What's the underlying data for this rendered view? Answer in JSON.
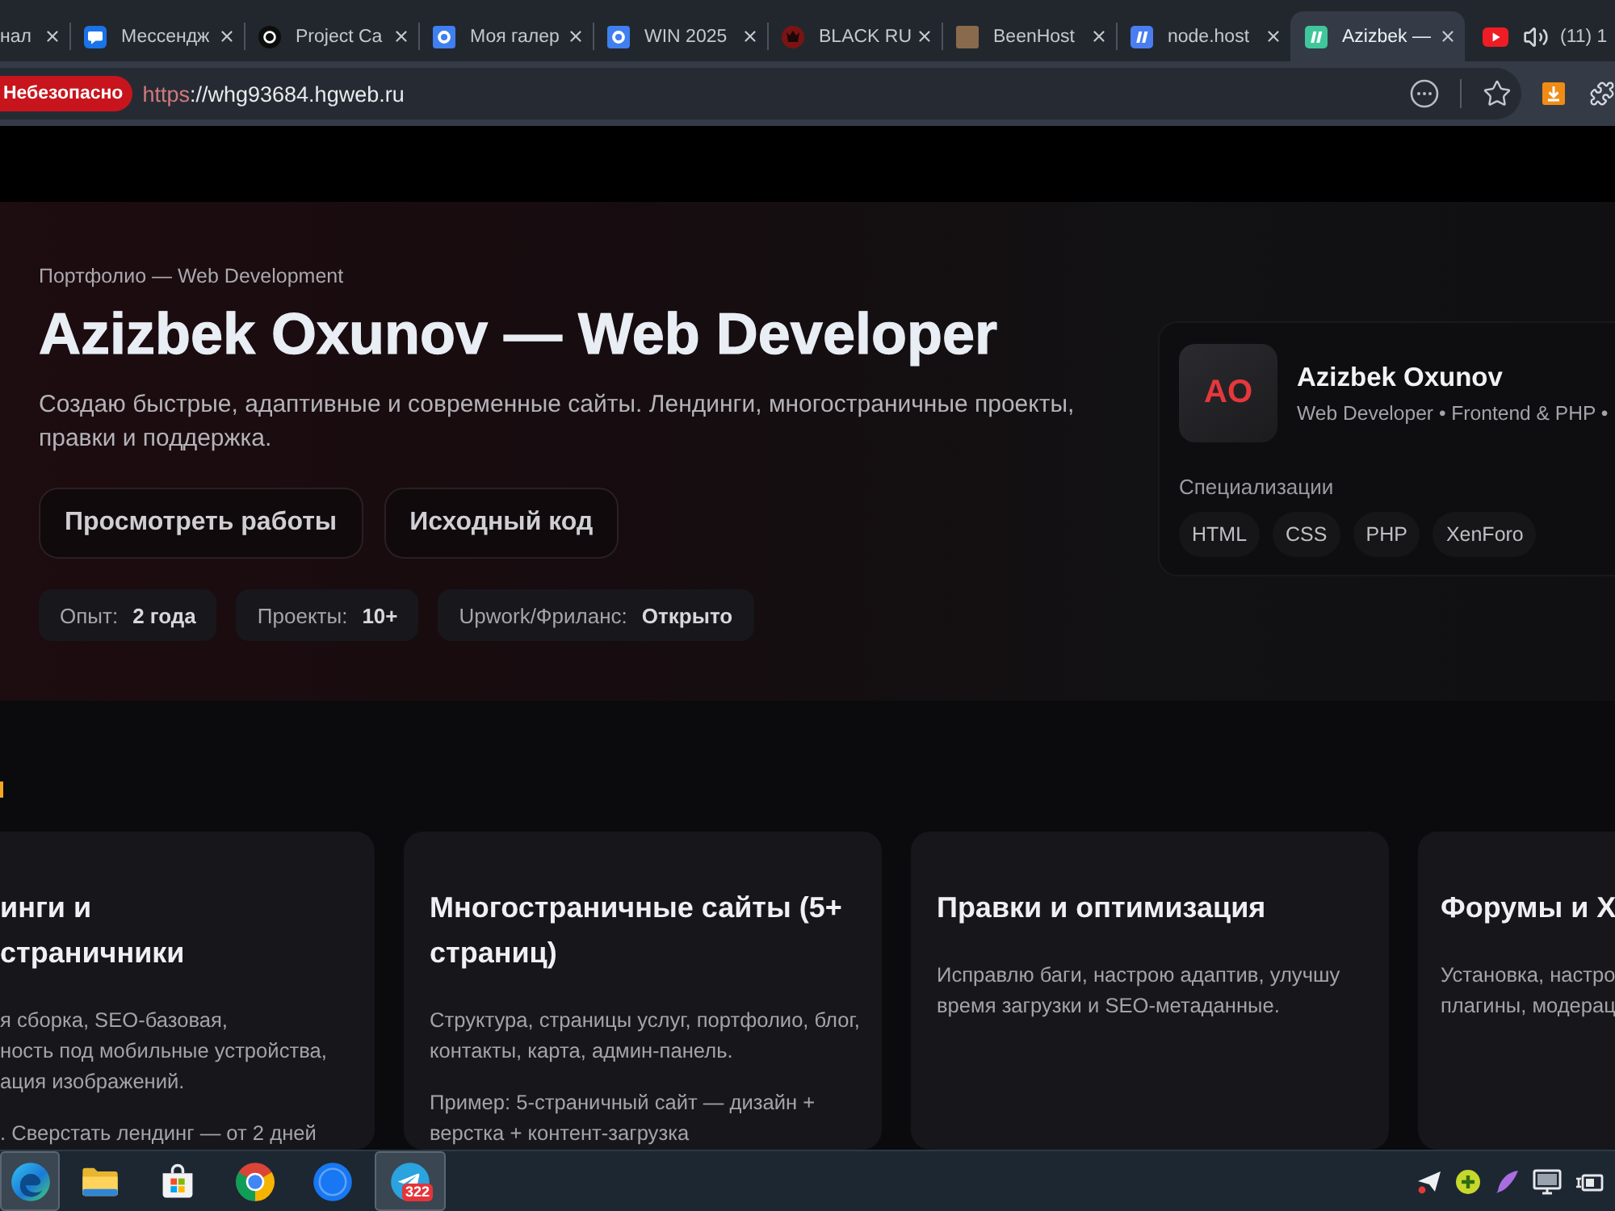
{
  "browser": {
    "tabs": [
      {
        "kind": "none",
        "title": "нал",
        "selected": false,
        "closable": true,
        "sound": false
      },
      {
        "kind": "bubble",
        "title": "Мессендж",
        "selected": false,
        "closable": true,
        "sound": false
      },
      {
        "kind": "disc",
        "title": "Project Ca",
        "selected": false,
        "closable": true,
        "sound": false
      },
      {
        "kind": "tile",
        "title": "Моя галер",
        "selected": false,
        "closable": true,
        "sound": false
      },
      {
        "kind": "tile",
        "title": "WIN 2025",
        "selected": false,
        "closable": true,
        "sound": false
      },
      {
        "kind": "emblem",
        "title": "BLACK RU",
        "selected": false,
        "closable": true,
        "sound": false
      },
      {
        "kind": "photo",
        "title": "BeenHost",
        "selected": false,
        "closable": true,
        "sound": false
      },
      {
        "kind": "slashes",
        "color": "#4a7df0",
        "title": "node.host",
        "selected": false,
        "closable": true,
        "sound": false
      },
      {
        "kind": "slashes",
        "color": "#3fc79b",
        "title": "Azizbek —",
        "selected": true,
        "closable": true,
        "sound": false
      },
      {
        "kind": "video",
        "title": "(11) 1",
        "selected": false,
        "closable": false,
        "sound": true
      }
    ],
    "address_bar": {
      "security_label": "Небезопасно",
      "insecure": true,
      "scheme": "https",
      "rest": "://whg93684.hgweb.ru"
    }
  },
  "hero": {
    "eyebrow": "Портфолио — Web Development",
    "title": "Azizbek Oxunov — Web Developer",
    "lead": "Создаю быстрые, адаптивные и современные сайты. Лендинги, многостраничные проекты, правки и поддержка.",
    "buttons": [
      "Просмотреть работы",
      "Исходный код"
    ],
    "stats": [
      {
        "label": "Опыт:",
        "value": "2 года"
      },
      {
        "label": "Проекты:",
        "value": "10+"
      },
      {
        "label": "Upwork/Фриланс:",
        "value": "Открыто"
      }
    ]
  },
  "profile_card": {
    "initials": "AO",
    "name": "Azizbek Oxunov",
    "role": "Web Developer • Frontend & PHP •",
    "skills_label": "Специализации",
    "skills": [
      "HTML",
      "CSS",
      "PHP",
      "XenForo"
    ]
  },
  "services": [
    {
      "title_lines": [
        "инги и",
        "страничники"
      ],
      "paragraphs": [
        [
          "я сборка, SEO-базовая,",
          "ность под мобильные устройства,",
          "ация изображений."
        ],
        [
          ". Сверстать лендинг — от 2 дней"
        ]
      ]
    },
    {
      "title_lines": [
        "Многостраничные сайты (5+",
        "страниц)"
      ],
      "paragraphs": [
        [
          "Структура, страницы услуг, портфолио, блог,",
          "контакты, карта, админ-панель."
        ],
        [
          "Пример: 5-страничный сайт — дизайн +",
          "верстка + контент-загрузка"
        ]
      ]
    },
    {
      "title_lines": [
        "Правки и оптимизация"
      ],
      "paragraphs": [
        [
          "Исправлю баги, настрою адаптив, улучшу",
          "время загрузки и SEO-метаданные."
        ]
      ]
    },
    {
      "title_lines": [
        "Форумы и Х"
      ],
      "paragraphs": [
        [
          "Установка, настро",
          "плагины, модерац"
        ]
      ]
    }
  ],
  "taskbar": {
    "apps": [
      {
        "kind": "swirl",
        "active": true
      },
      {
        "kind": "folder",
        "active": false
      },
      {
        "kind": "bag",
        "active": false
      },
      {
        "kind": "ring",
        "active": false
      },
      {
        "kind": "disc",
        "active": false
      },
      {
        "kind": "plane",
        "active": true,
        "badge": "322"
      }
    ]
  }
}
